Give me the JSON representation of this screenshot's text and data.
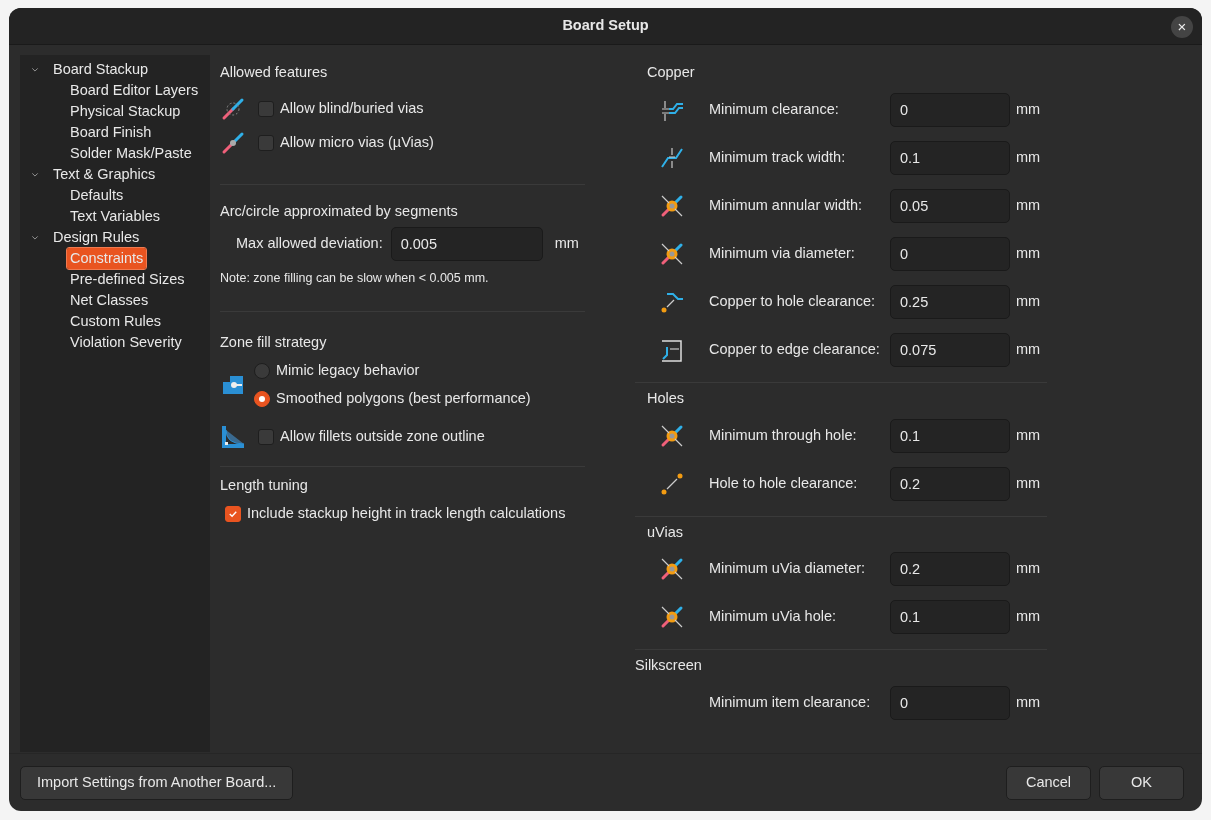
{
  "window": {
    "title": "Board Setup",
    "close": "×"
  },
  "sidebar": {
    "items": [
      {
        "label": "Board Stackup",
        "expanded": true,
        "selected": false,
        "children": [
          {
            "label": "Board Editor Layers",
            "selected": false
          },
          {
            "label": "Physical Stackup",
            "selected": false
          },
          {
            "label": "Board Finish",
            "selected": false
          },
          {
            "label": "Solder Mask/Paste",
            "selected": false
          }
        ]
      },
      {
        "label": "Text & Graphics",
        "expanded": true,
        "selected": false,
        "children": [
          {
            "label": "Defaults",
            "selected": false
          },
          {
            "label": "Text Variables",
            "selected": false
          }
        ]
      },
      {
        "label": "Design Rules",
        "expanded": true,
        "selected": false,
        "children": [
          {
            "label": "Constraints",
            "selected": true
          },
          {
            "label": "Pre-defined Sizes",
            "selected": false
          },
          {
            "label": "Net Classes",
            "selected": false
          },
          {
            "label": "Custom Rules",
            "selected": false
          },
          {
            "label": "Violation Severity",
            "selected": false
          }
        ]
      }
    ]
  },
  "allowed_features": {
    "title": "Allowed features",
    "options": [
      {
        "label": "Allow blind/buried vias",
        "checked": false
      },
      {
        "label": "Allow micro vias (µVias)",
        "checked": false
      }
    ]
  },
  "arc": {
    "title": "Arc/circle approximated by segments",
    "label": "Max allowed deviation:",
    "value": "0.005",
    "unit": "mm",
    "note": "Note: zone filling can be slow when < 0.005 mm."
  },
  "zone_fill": {
    "title": "Zone fill strategy",
    "options": [
      {
        "label": "Mimic legacy behavior",
        "selected": false
      },
      {
        "label": "Smoothed polygons (best performance)",
        "selected": true
      }
    ],
    "fillets": {
      "label": "Allow fillets outside zone outline",
      "checked": false
    }
  },
  "length_tuning": {
    "title": "Length tuning",
    "option": {
      "label": "Include stackup height in track length calculations",
      "checked": true
    }
  },
  "groups": [
    {
      "title": "Copper",
      "rows": [
        {
          "kind": "clearance",
          "label": "Minimum clearance:",
          "value": "0",
          "unit": "mm"
        },
        {
          "kind": "track",
          "label": "Minimum track width:",
          "value": "0.1",
          "unit": "mm"
        },
        {
          "kind": "via",
          "label": "Minimum annular width:",
          "value": "0.05",
          "unit": "mm"
        },
        {
          "kind": "via",
          "label": "Minimum via diameter:",
          "value": "0",
          "unit": "mm"
        },
        {
          "kind": "holeclearance",
          "label": "Copper to hole clearance:",
          "value": "0.25",
          "unit": "mm"
        },
        {
          "kind": "edge",
          "label": "Copper to edge clearance:",
          "value": "0.075",
          "unit": "mm"
        }
      ]
    },
    {
      "title": "Holes",
      "rows": [
        {
          "kind": "via",
          "label": "Minimum through hole:",
          "value": "0.1",
          "unit": "mm"
        },
        {
          "kind": "holespacing",
          "label": "Hole to hole clearance:",
          "value": "0.2",
          "unit": "mm"
        }
      ]
    },
    {
      "title": "uVias",
      "rows": [
        {
          "kind": "via",
          "label": "Minimum uVia diameter:",
          "value": "0.2",
          "unit": "mm"
        },
        {
          "kind": "via",
          "label": "Minimum uVia hole:",
          "value": "0.1",
          "unit": "mm"
        }
      ]
    },
    {
      "title": "Silkscreen",
      "rows": [
        {
          "kind": "plain",
          "label": "Minimum item clearance:",
          "value": "0",
          "unit": "mm"
        }
      ]
    }
  ],
  "footer": {
    "import_button": "Import Settings from Another Board...",
    "cancel_button": "Cancel",
    "ok_button": "OK"
  }
}
